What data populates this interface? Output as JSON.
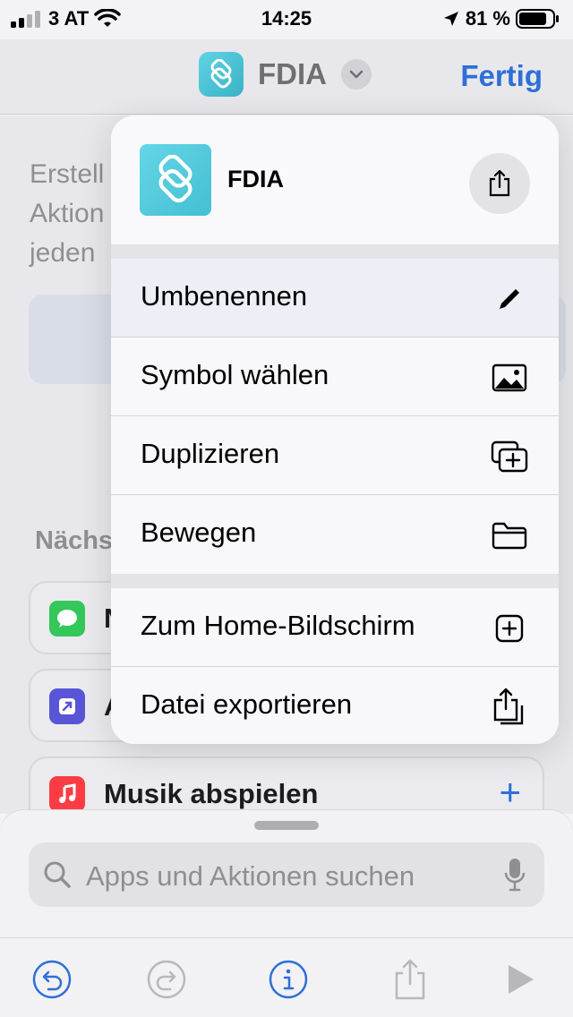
{
  "status_bar": {
    "carrier": "3 AT",
    "time": "14:25",
    "battery": "81 %"
  },
  "nav": {
    "title": "FDIA",
    "done_label": "Fertig",
    "accent": "#2f6fd6"
  },
  "background": {
    "description_lines": [
      "Erstell",
      "Aktion",
      "jeden"
    ],
    "section_title": "Nächs",
    "rows": [
      {
        "label": "N",
        "icon": "messages-icon",
        "color": "#34c759"
      },
      {
        "label": "A",
        "icon": "shortcut-icon",
        "color": "#5856d6"
      },
      {
        "label": "Musik abspielen",
        "icon": "music-icon",
        "color": "#fc3c44"
      }
    ]
  },
  "menu": {
    "title": "FDIA",
    "items": [
      {
        "label": "Umbenennen",
        "icon": "pencil-icon"
      },
      {
        "label": "Symbol wählen",
        "icon": "photo-icon"
      },
      {
        "label": "Duplizieren",
        "icon": "duplicate-icon"
      },
      {
        "label": "Bewegen",
        "icon": "folder-icon"
      },
      {
        "label": "Zum Home-Bildschirm",
        "icon": "add-square-icon"
      },
      {
        "label": "Datei exportieren",
        "icon": "export-file-icon"
      }
    ]
  },
  "sheet": {
    "search_placeholder": "Apps und Aktionen suchen"
  }
}
